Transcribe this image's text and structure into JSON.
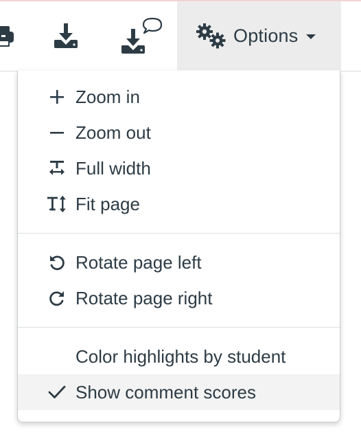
{
  "toolbar": {
    "options_label": "Options",
    "icons": {
      "print": "printer-icon",
      "download": "download-icon",
      "download_annotated": "download-with-comment-icon",
      "options": "gears-icon"
    }
  },
  "menu": {
    "zoom_group": [
      {
        "label": "Zoom in",
        "icon": "plus-icon"
      },
      {
        "label": "Zoom out",
        "icon": "minus-icon"
      },
      {
        "label": "Full width",
        "icon": "fit-width-icon"
      },
      {
        "label": "Fit page",
        "icon": "fit-page-icon"
      }
    ],
    "rotate_group": [
      {
        "label": "Rotate page left",
        "icon": "rotate-left-icon"
      },
      {
        "label": "Rotate page right",
        "icon": "rotate-right-icon"
      }
    ],
    "display_group": [
      {
        "label": "Color highlights by student",
        "checked": false
      },
      {
        "label": "Show comment scores",
        "checked": true,
        "icon": "checkmark-icon"
      }
    ]
  },
  "colors": {
    "text": "#2d3b45",
    "options_bg": "#ececec",
    "selected_bg": "#f3f3f3",
    "divider": "#dcdfe1"
  }
}
